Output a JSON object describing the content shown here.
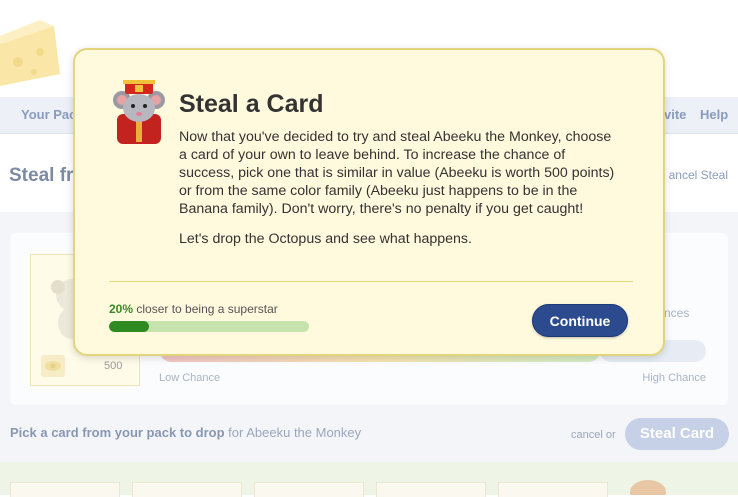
{
  "nav": {
    "items": [
      "Your Pac",
      "vite",
      "Help"
    ]
  },
  "page": {
    "steal_heading": "Steal fr",
    "cancel_steal": "ancel Steal",
    "card_points": "500",
    "chances_fragment": "nces",
    "low_chance": "Low Chance",
    "high_chance": "High Chance",
    "pick_prefix": "Pick a card from your pack to drop",
    "pick_suffix": " for Abeeku the Monkey",
    "cancel_or": "cancel or",
    "steal_card_button": "Steal Card"
  },
  "modal": {
    "title": "Steal a Card",
    "paragraph1": "Now that you've decided to try and steal Abeeku the Monkey, choose a card of your own to leave behind. To increase the chance of success, pick one that is similar in value (Abeeku is worth 500 points) or from the same color family (Abeeku just happens to be in the Banana family). Don't worry, there's no penalty if you get caught!",
    "paragraph2": "Let's drop the Octopus and see what happens.",
    "progress_percent": "20%",
    "progress_text": " closer to being a superstar",
    "progress_value": 0.2,
    "continue_label": "Continue",
    "rat_icon": "rat-emperor-icon"
  },
  "colors": {
    "modal_bg": "#fff9dd",
    "modal_border": "#e3d57b",
    "continue_btn": "#2c4b8e",
    "progress_fill": "#2f8a22",
    "progress_track": "#c6e3ad"
  }
}
